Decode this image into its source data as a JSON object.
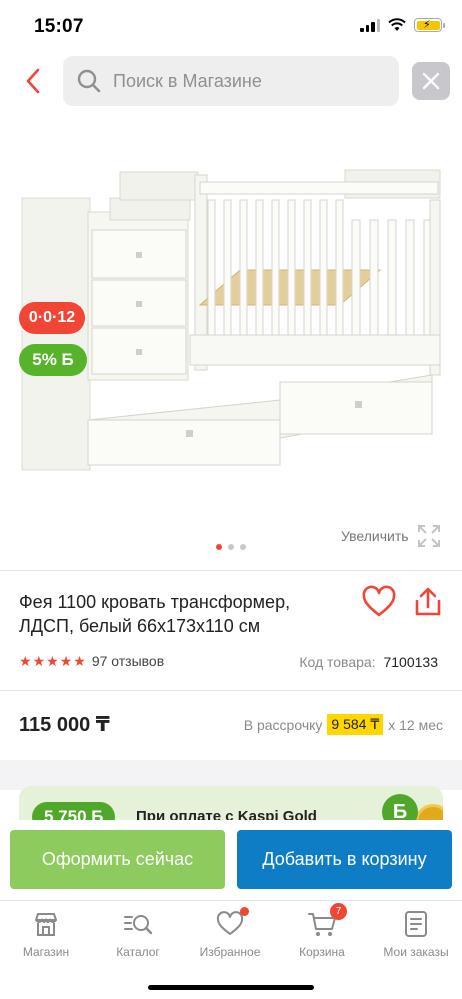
{
  "status_bar": {
    "time": "15:07"
  },
  "search": {
    "placeholder": "Поиск в Магазине"
  },
  "product": {
    "badge_installment": "0·0·12",
    "badge_bonus": "5% Б",
    "zoom_label": "Увеличить",
    "gallery": {
      "total": 3,
      "active": 1
    },
    "title": "Фея 1100 кровать трансформер, ЛДСП, белый 66х173х110 см",
    "rating": 5,
    "reviews": "97 отзывов",
    "code_label": "Код товара:",
    "code_value": "7100133",
    "price": "115 000 ₸",
    "installment_prefix": "В рассрочку",
    "installment_amount": "9 584 ₸",
    "installment_suffix": "x 12 мес"
  },
  "promo": {
    "bonus": "5 750 Б",
    "text": "При оплате с Kaspi Gold",
    "coin": "Б"
  },
  "actions": {
    "order_label": "Оформить сейчас",
    "cart_label": "Добавить в корзину"
  },
  "tabs": [
    {
      "label": "Магазин",
      "icon": "store-icon"
    },
    {
      "label": "Каталог",
      "icon": "catalog-search-icon"
    },
    {
      "label": "Избранное",
      "icon": "heart-icon",
      "dot": true
    },
    {
      "label": "Корзина",
      "icon": "cart-icon",
      "badge": "7"
    },
    {
      "label": "Мои заказы",
      "icon": "orders-icon"
    }
  ],
  "colors": {
    "accent_red": "#f14635",
    "bonus_green": "#56b32a",
    "order_button": "#8ecb5e",
    "cart_button": "#0f7dc6",
    "installment_highlight": "#ffd600"
  }
}
